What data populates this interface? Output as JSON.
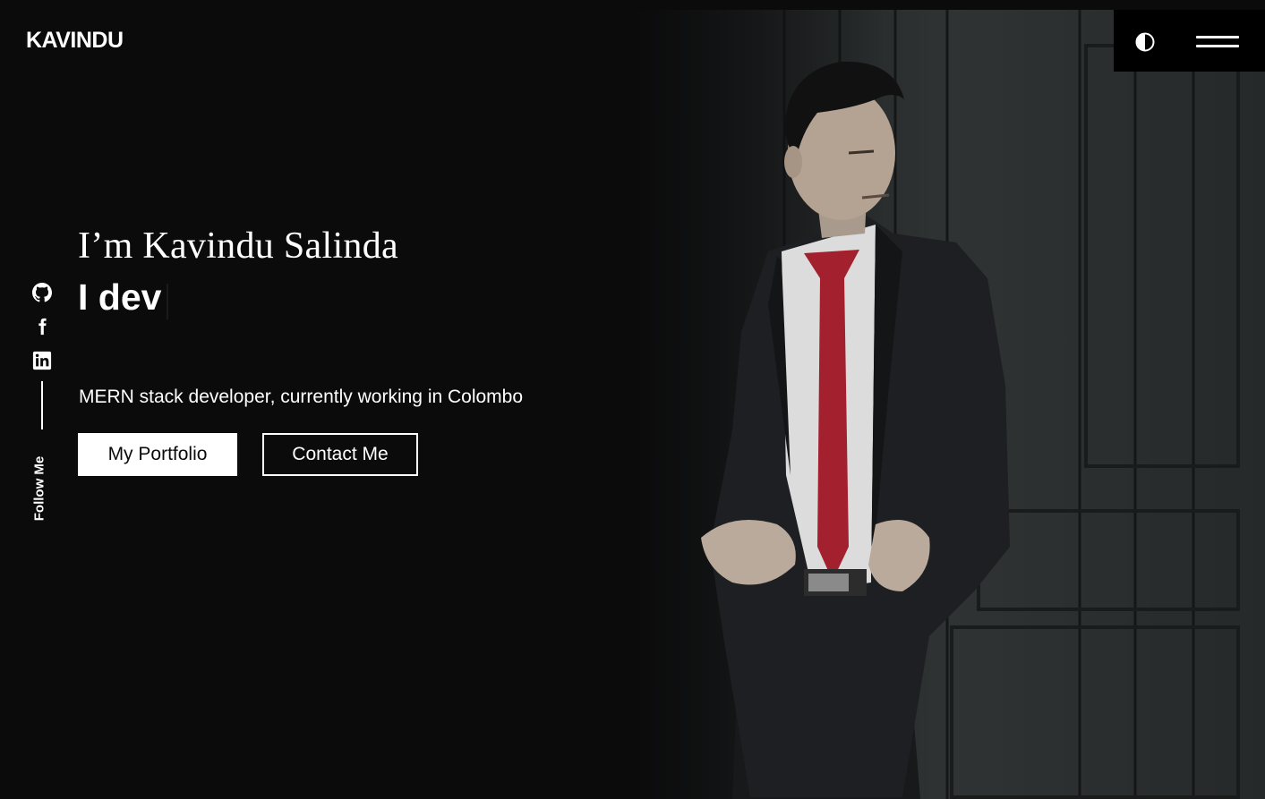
{
  "header": {
    "logo": "KAVINDU",
    "theme_toggle_icon": "contrast-icon",
    "menu_icon": "hamburger-menu-icon"
  },
  "social": {
    "items": [
      {
        "name": "github",
        "icon": "github-icon"
      },
      {
        "name": "facebook",
        "icon": "facebook-icon"
      },
      {
        "name": "linkedin",
        "icon": "linkedin-icon"
      }
    ],
    "follow_label": "Follow Me"
  },
  "hero": {
    "intro": "I’m Kavindu Salinda",
    "typed_text": "I dev",
    "description": "MERN stack developer, currently working in Colombo",
    "buttons": {
      "portfolio": "My Portfolio",
      "contact": "Contact Me"
    }
  },
  "colors": {
    "background": "#0b0b0c",
    "text": "#ffffff",
    "tie": "#a3202e",
    "door": "#2a2d2d"
  }
}
